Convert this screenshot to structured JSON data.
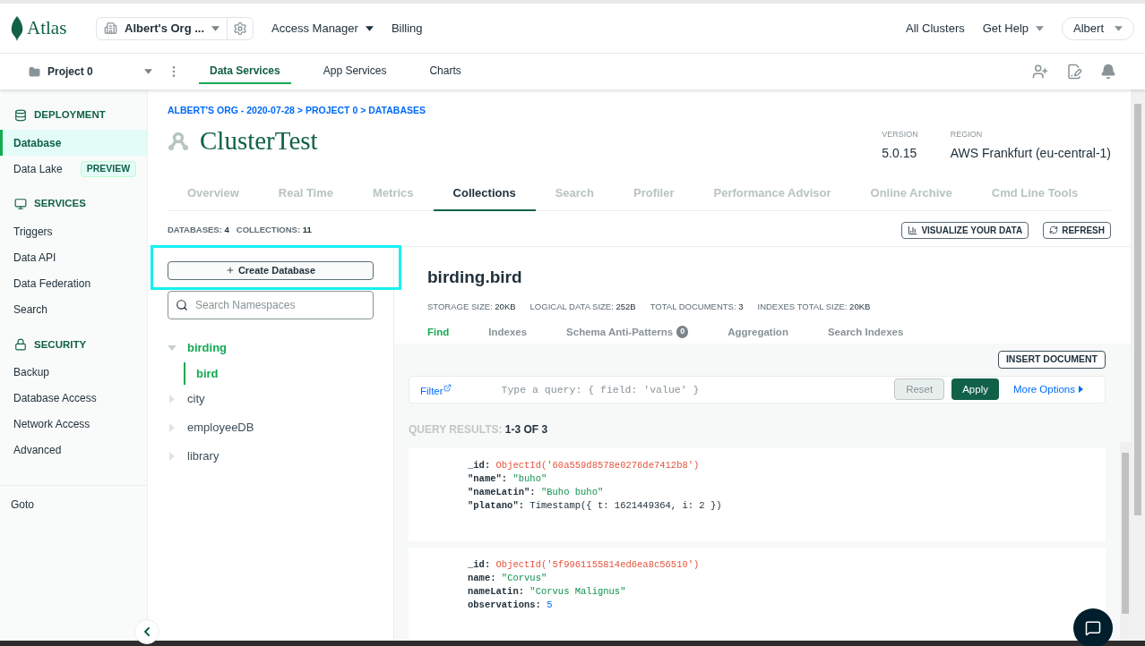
{
  "topbar": {
    "logo": "Atlas",
    "org": "Albert's Org ...",
    "nav": [
      {
        "label": "Access Manager",
        "dropdown": true
      },
      {
        "label": "Billing",
        "dropdown": false
      }
    ],
    "right": [
      {
        "label": "All Clusters",
        "dropdown": false
      },
      {
        "label": "Get Help",
        "dropdown": true
      }
    ],
    "user": "Albert"
  },
  "projectbar": {
    "project": "Project 0",
    "tabs": [
      {
        "label": "Data Services",
        "selected": true
      },
      {
        "label": "App Services",
        "selected": false
      },
      {
        "label": "Charts",
        "selected": false
      }
    ]
  },
  "sidebar": {
    "sections": [
      {
        "title": "DEPLOYMENT",
        "items": [
          {
            "label": "Database",
            "selected": true
          },
          {
            "label": "Data Lake",
            "selected": false,
            "badge": "PREVIEW"
          }
        ]
      },
      {
        "title": "SERVICES",
        "items": [
          {
            "label": "Triggers",
            "selected": false
          },
          {
            "label": "Data API",
            "selected": false
          },
          {
            "label": "Data Federation",
            "selected": false
          },
          {
            "label": "Search",
            "selected": false
          }
        ]
      },
      {
        "title": "SECURITY",
        "items": [
          {
            "label": "Backup",
            "selected": false
          },
          {
            "label": "Database Access",
            "selected": false
          },
          {
            "label": "Network Access",
            "selected": false
          },
          {
            "label": "Advanced",
            "selected": false
          }
        ]
      }
    ],
    "footer": "Goto"
  },
  "breadcrumb": "ALBERT'S ORG - 2020-07-28 > PROJECT 0 > DATABASES",
  "cluster": {
    "name": "ClusterTest",
    "version_label": "VERSION",
    "version": "5.0.15",
    "region_label": "REGION",
    "region": "AWS Frankfurt (eu-central-1)"
  },
  "cluster_tabs": [
    {
      "label": "Overview",
      "selected": false
    },
    {
      "label": "Real Time",
      "selected": false
    },
    {
      "label": "Metrics",
      "selected": false
    },
    {
      "label": "Collections",
      "selected": true
    },
    {
      "label": "Search",
      "selected": false
    },
    {
      "label": "Profiler",
      "selected": false
    },
    {
      "label": "Performance Advisor",
      "selected": false
    },
    {
      "label": "Online Archive",
      "selected": false
    },
    {
      "label": "Cmd Line Tools",
      "selected": false
    }
  ],
  "counts": [
    {
      "label": "DATABASES:",
      "value": "4"
    },
    {
      "label": "COLLECTIONS:",
      "value": "11"
    }
  ],
  "actions": [
    "VISUALIZE YOUR DATA",
    "REFRESH"
  ],
  "tree": {
    "create_button": "Create Database",
    "search_placeholder": "Search Namespaces",
    "databases": [
      {
        "name": "birding",
        "expanded": true,
        "children": [
          {
            "name": "bird",
            "selected": true
          }
        ]
      },
      {
        "name": "city",
        "expanded": false
      },
      {
        "name": "employeeDB",
        "expanded": false
      },
      {
        "name": "library",
        "expanded": false
      }
    ]
  },
  "collection": {
    "name": "birding.bird",
    "stats": [
      {
        "label": "STORAGE SIZE:",
        "value": "20KB"
      },
      {
        "label": "LOGICAL DATA SIZE:",
        "value": "252B"
      },
      {
        "label": "TOTAL DOCUMENTS:",
        "value": "3"
      },
      {
        "label": "INDEXES TOTAL SIZE:",
        "value": "20KB"
      }
    ],
    "tabs": [
      {
        "label": "Find",
        "selected": true
      },
      {
        "label": "Indexes",
        "selected": false
      },
      {
        "label": "Schema Anti-Patterns",
        "selected": false,
        "count": "0"
      },
      {
        "label": "Aggregation",
        "selected": false
      },
      {
        "label": "Search Indexes",
        "selected": false
      }
    ],
    "insert_button": "INSERT DOCUMENT",
    "filter": {
      "label": "Filter",
      "placeholder": "Type a query: { field: 'value' }",
      "reset": "Reset",
      "apply": "Apply",
      "more": "More Options"
    },
    "results_label": "QUERY RESULTS:",
    "results_count": "1-3 OF 3",
    "documents": [
      {
        "fields": [
          {
            "key": "_id:",
            "value": "ObjectId('60a559d8578e0276de7412b8')",
            "kind": "objectid"
          },
          {
            "key": "\"name\":",
            "value": "\"buho\"",
            "kind": "string"
          },
          {
            "key": "\"nameLatin\":",
            "value": "\"Buho buho\"",
            "kind": "string"
          },
          {
            "key": "\"platano\":",
            "value": "Timestamp({ t: 1621449364, i: 2 })",
            "kind": "plain"
          }
        ]
      },
      {
        "fields": [
          {
            "key": "_id:",
            "value": "ObjectId('5f9961155814ed6ea8c56510')",
            "kind": "objectid"
          },
          {
            "key": "name:",
            "value": "\"Corvus\"",
            "kind": "string"
          },
          {
            "key": "nameLatin:",
            "value": "\"Corvus Malignus\"",
            "kind": "string"
          },
          {
            "key": "observations:",
            "value": "5",
            "kind": "number"
          }
        ]
      }
    ]
  }
}
